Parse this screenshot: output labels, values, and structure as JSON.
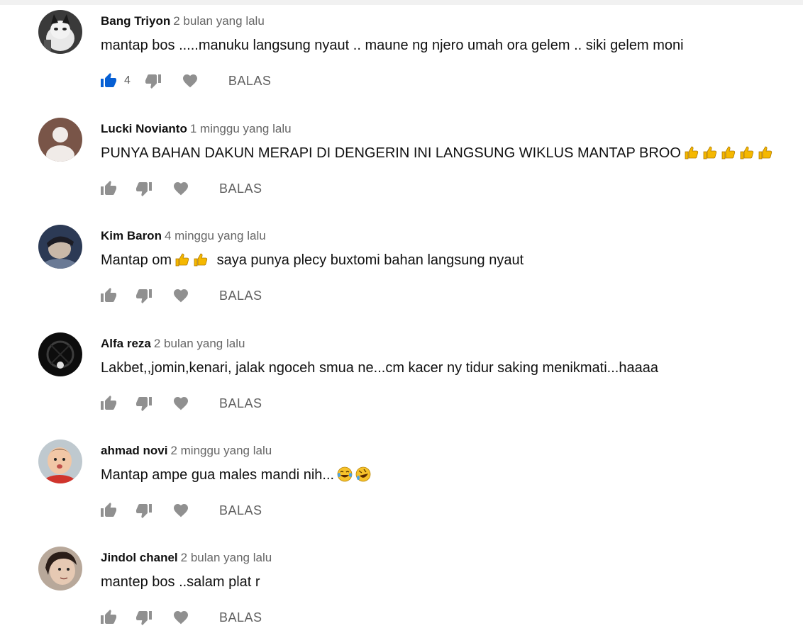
{
  "reply_label": "BALAS",
  "colors": {
    "like_active": "#065fd4",
    "icon_gray": "#909090",
    "meta_gray": "#606060"
  },
  "comments": [
    {
      "author": "Bang Triyon",
      "time": "2 bulan yang lalu",
      "text": "mantap bos .....manuku langsung nyaut .. maune ng njero umah ora gelem .. siki gelem moni",
      "like_count": "4",
      "liked": true,
      "emoji": []
    },
    {
      "author": "Lucki Novianto",
      "time": "1 minggu yang lalu",
      "text": "PUNYA BAHAN DAKUN MERAPI DI DENGERIN INI LANGSUNG WIKLUS MANTAP BROO",
      "like_count": "",
      "liked": false,
      "emoji": [
        "thumbs-up-emoji",
        "thumbs-up-emoji",
        "thumbs-up-emoji",
        "thumbs-up-emoji",
        "thumbs-up-emoji"
      ]
    },
    {
      "author": "Kim Baron",
      "time": "4 minggu yang lalu",
      "text_before": "Mantap om",
      "text": "saya punya plecy buxtomi bahan langsung nyaut",
      "like_count": "",
      "liked": false,
      "emoji": [
        "thumbs-up-emoji",
        "thumbs-up-emoji"
      ]
    },
    {
      "author": "Alfa reza",
      "time": "2 bulan yang lalu",
      "text": "Lakbet,,jomin,kenari, jalak ngoceh smua ne...cm kacer ny tidur saking menikmati...haaaa",
      "like_count": "",
      "liked": false,
      "emoji": []
    },
    {
      "author": "ahmad novi",
      "time": "2 minggu yang lalu",
      "text": "Mantap ampe gua males mandi nih...",
      "like_count": "",
      "liked": false,
      "emoji": [
        "tears-of-joy-emoji",
        "rolling-laughing-emoji"
      ]
    },
    {
      "author": "Jindol chanel",
      "time": "2 bulan yang lalu",
      "text": "mantep bos ..salam plat r",
      "like_count": "",
      "liked": false,
      "emoji": []
    }
  ]
}
